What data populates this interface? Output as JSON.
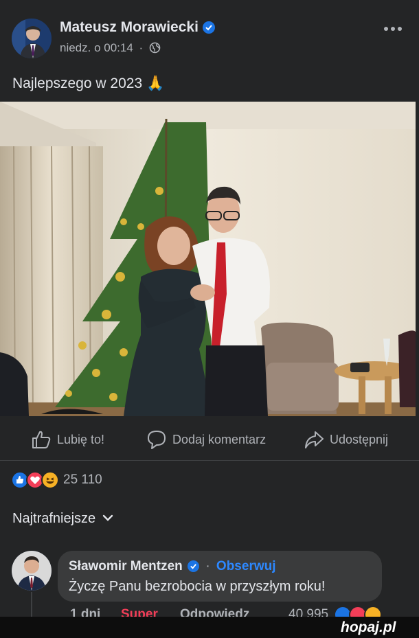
{
  "post": {
    "author": "Mateusz Morawiecki",
    "time": "niedz. o 00:14",
    "separator": "·",
    "text": "Najlepszego w 2023 🙏",
    "more_icon": "more-horizontal-icon"
  },
  "actions": {
    "like": "Lubię to!",
    "comment": "Dodaj komentarz",
    "share": "Udostępnij"
  },
  "reactions": {
    "count": "25 110",
    "types": [
      "like",
      "love",
      "haha"
    ]
  },
  "sort": {
    "label": "Najtrafniejsze"
  },
  "comment": {
    "author": "Sławomir Mentzen",
    "dot": "·",
    "follow": "Obserwuj",
    "text": "Życzę Panu bezrobocia w przyszłym roku!",
    "meta_time": "1 dni",
    "meta_reaction": "Super",
    "meta_reply": "Odpowiedz",
    "meta_count": "40 995"
  },
  "watermark": "hopaj.pl",
  "colors": {
    "background": "#242526",
    "accent_blue": "#1b74e4",
    "follow_blue": "#2d88ff",
    "bubble": "#3a3b3c",
    "super_red": "#f33e58"
  }
}
